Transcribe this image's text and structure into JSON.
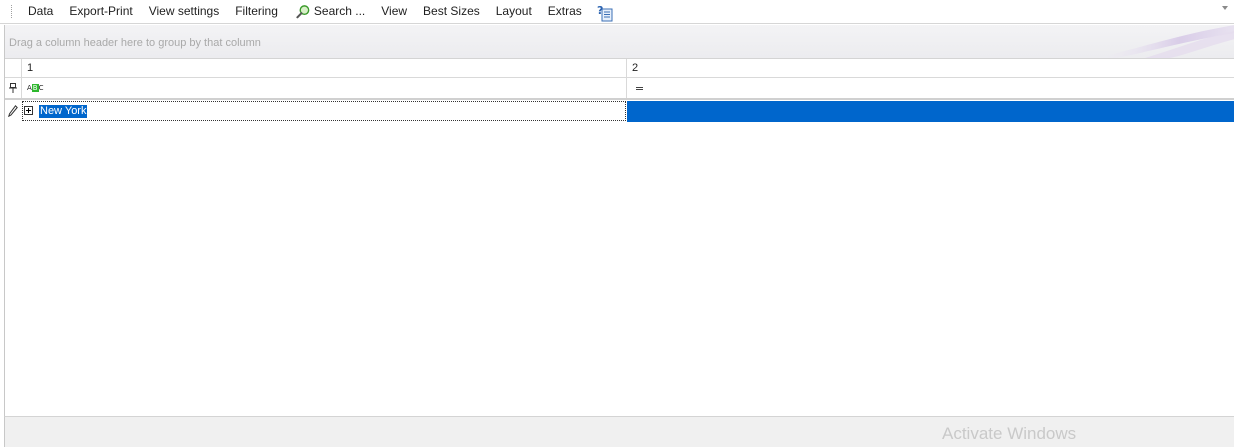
{
  "menubar": {
    "items": [
      "Data",
      "Export-Print",
      "View settings",
      "Filtering",
      "Search ...",
      "View",
      "Best Sizes",
      "Layout",
      "Extras"
    ]
  },
  "grid": {
    "group_hint": "Drag a column header here to group by that column",
    "columns": [
      "1",
      "2"
    ],
    "rows": [
      {
        "col1": "New York",
        "col2": ""
      }
    ]
  },
  "watermark": "Activate Windows",
  "colors": {
    "selection": "#0066cc",
    "accent_green": "#2eb82e"
  }
}
